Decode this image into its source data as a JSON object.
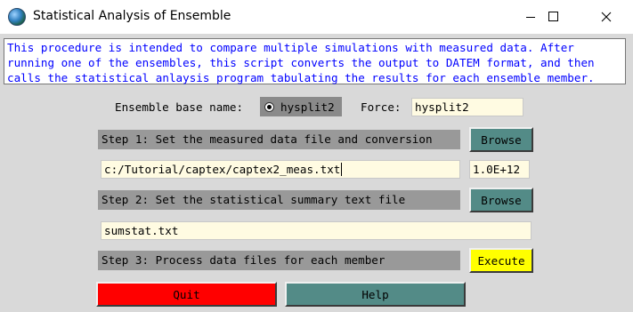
{
  "window": {
    "title": "Statistical Analysis of Ensemble",
    "controls": {
      "minimize": "minimize-icon",
      "maximize": "maximize-icon",
      "close": "close-icon"
    }
  },
  "description": {
    "line1": "This procedure is intended to compare multiple simulations with measured data. After",
    "line2": "running one of the ensembles, this script converts the output to DATEM format, and then",
    "line3": "calls the statistical anlaysis program tabulating the results for each ensemble member."
  },
  "ensemble": {
    "label": "Ensemble base name:",
    "radio_label": "hysplit2",
    "radio_selected": true,
    "force_label": "Force:",
    "force_value": "hysplit2"
  },
  "step1": {
    "label": "Step 1: Set the measured data file and conversion",
    "browse_label": "Browse",
    "file_value": "c:/Tutorial/captex/captex2_meas.txt",
    "conversion_value": "1.0E+12"
  },
  "step2": {
    "label": "Step 2: Set the statistical summary text file",
    "browse_label": "Browse",
    "file_value": "sumstat.txt"
  },
  "step3": {
    "label": "Step 3: Process data files for each member",
    "execute_label": "Execute"
  },
  "footer": {
    "quit_label": "Quit",
    "help_label": "Help"
  },
  "colors": {
    "background": "#d9d9d9",
    "description_text": "#0000ff",
    "step_bar": "#999999",
    "teal_button": "#538b87",
    "execute_button": "#ffff00",
    "quit_button": "#ff0000",
    "field_bg": "#fffbe2"
  }
}
